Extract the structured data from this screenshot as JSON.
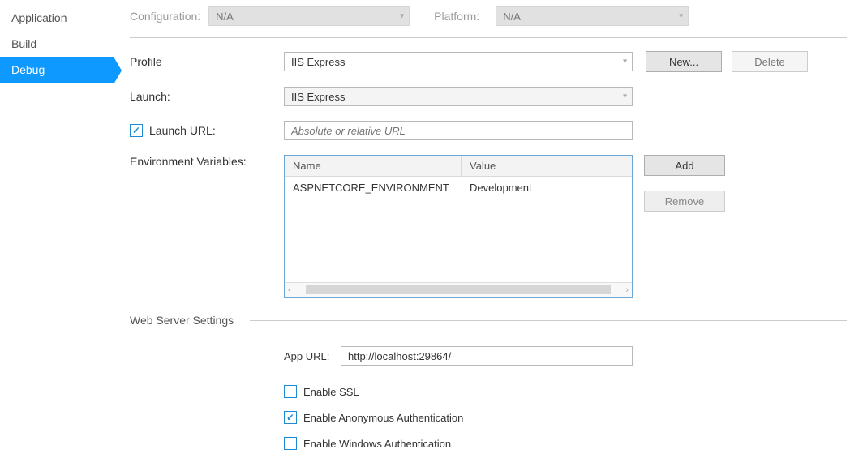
{
  "sidebar": {
    "items": [
      {
        "label": "Application"
      },
      {
        "label": "Build"
      },
      {
        "label": "Debug"
      }
    ]
  },
  "cfg": {
    "config_label": "Configuration:",
    "config_value": "N/A",
    "platform_label": "Platform:",
    "platform_value": "N/A"
  },
  "profile": {
    "label": "Profile",
    "value": "IIS Express",
    "new_btn": "New...",
    "delete_btn": "Delete"
  },
  "launch": {
    "label": "Launch:",
    "value": "IIS Express"
  },
  "launch_url": {
    "label": "Launch URL:",
    "placeholder": "Absolute or relative URL",
    "checked": true
  },
  "env": {
    "label": "Environment Variables:",
    "col_name": "Name",
    "col_value": "Value",
    "rows": [
      {
        "name": "ASPNETCORE_ENVIRONMENT",
        "value": "Development"
      }
    ],
    "add_btn": "Add",
    "remove_btn": "Remove"
  },
  "webserver": {
    "heading": "Web Server Settings",
    "appurl_label": "App URL:",
    "appurl_value": "http://localhost:29864/",
    "enable_ssl": "Enable SSL",
    "enable_anon": "Enable Anonymous Authentication",
    "enable_win": "Enable Windows Authentication"
  }
}
